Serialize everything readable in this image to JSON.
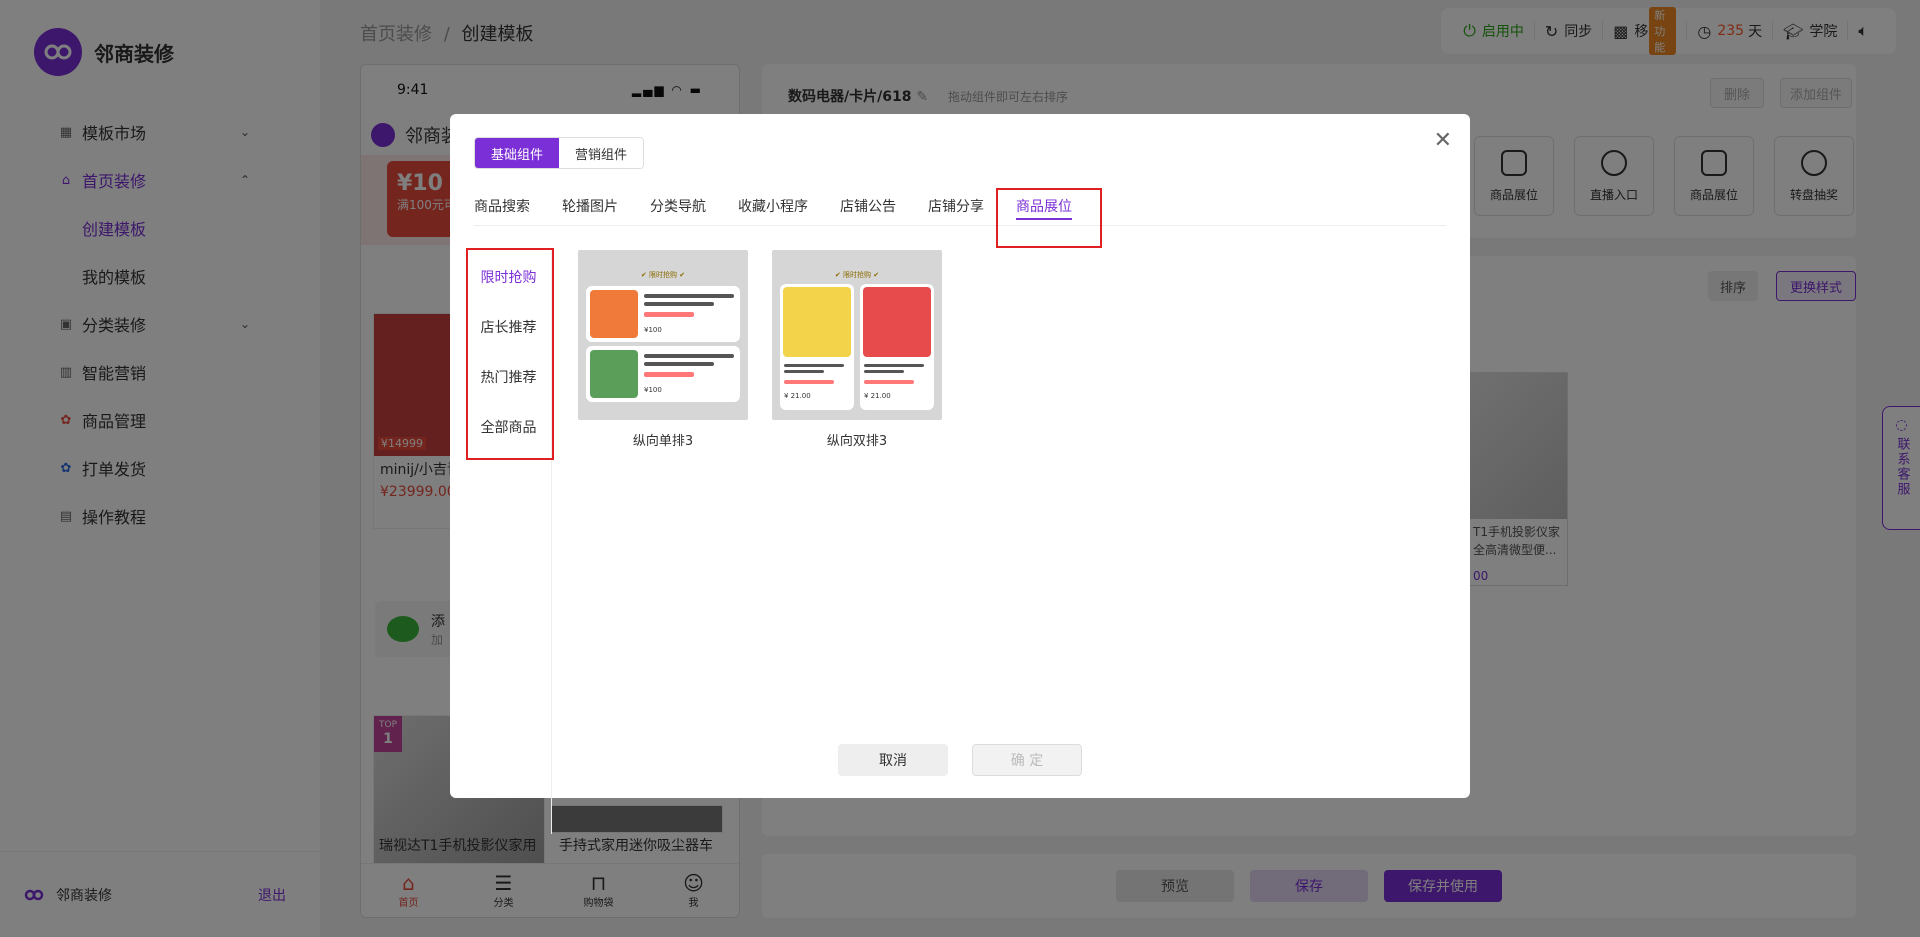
{
  "app": {
    "name": "邻商装修"
  },
  "sidebar": {
    "items": [
      {
        "label": "模板市场",
        "icon": "grid-icon"
      },
      {
        "label": "首页装修",
        "icon": "home-icon"
      },
      {
        "label": "创建模板"
      },
      {
        "label": "我的模板"
      },
      {
        "label": "分类装修",
        "icon": "category-icon"
      },
      {
        "label": "智能营销",
        "icon": "chart-icon"
      },
      {
        "label": "商品管理",
        "icon": "goods-icon"
      },
      {
        "label": "打单发货",
        "icon": "ship-icon"
      },
      {
        "label": "操作教程",
        "icon": "book-icon"
      }
    ],
    "footer_name": "邻商装修",
    "logout": "退出"
  },
  "header": {
    "breadcrumb_root": "首页装修",
    "breadcrumb_sep": "/",
    "breadcrumb_current": "创建模板",
    "tools": {
      "status": "启用中",
      "sync": "同步",
      "mobile": "移动端",
      "new_tag": "新功能",
      "days_num": "235",
      "days_unit": "天",
      "academy": "学院"
    }
  },
  "phone": {
    "time": "9:41",
    "shop_name": "邻商装",
    "coupon_amount": "¥10",
    "coupon_text": "满100元可",
    "product1_title": "minij/小吉青庭洗衣房系",
    "product1_price": "¥23999.00",
    "product1_tag": "¥14999",
    "wechat_title": "添",
    "wechat_sub": "加",
    "top_badge_top": "TOP",
    "top_badge_num": "1",
    "product2_title": "瑞视达T1手机投影仪家用",
    "product3_title": "手持式家用迷你吸尘器车",
    "tabs": [
      "首页",
      "分类",
      "购物袋",
      "我"
    ]
  },
  "editor": {
    "title": "数码电器/卡片/618",
    "hint": "拖动组件即可左右排序",
    "delete": "删除",
    "add_component": "添加组件",
    "components": [
      "商品展位",
      "直播入口",
      "商品展位",
      "转盘抽奖"
    ],
    "sort": "排序",
    "change_style": "更换样式",
    "proj_title": "T1手机投影仪家全高清微型便...",
    "proj_price": "00"
  },
  "footer_actions": {
    "preview": "预览",
    "save": "保存",
    "save_use": "保存并使用"
  },
  "contact": {
    "label": "联系客服"
  },
  "modal": {
    "seg": [
      "基础组件",
      "营销组件"
    ],
    "tabs": [
      "商品搜索",
      "轮播图片",
      "分类导航",
      "收藏小程序",
      "店铺公告",
      "店铺分享",
      "商品展位"
    ],
    "left_menu": [
      "限时抢购",
      "店长推荐",
      "热门推荐",
      "全部商品"
    ],
    "templates": [
      {
        "name": "纵向单排3",
        "header": "✔ 限时抢购 ✔"
      },
      {
        "name": "纵向双排3",
        "header": "✔ 限时抢购 ✔"
      }
    ],
    "tpl_price1": "¥100",
    "tpl_price2": "¥ 21.00",
    "cancel": "取消",
    "confirm": "确 定"
  },
  "colors": {
    "accent": "#7b2fd6",
    "highlight": "#e02020"
  }
}
